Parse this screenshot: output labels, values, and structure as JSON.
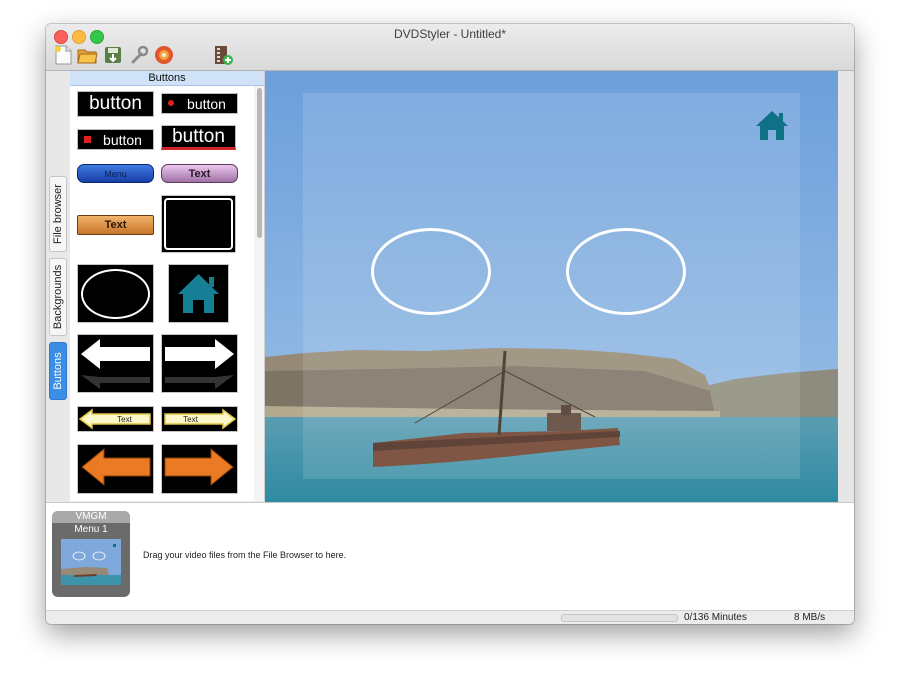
{
  "window": {
    "title": "DVDStyler - Untitled*"
  },
  "toolbar": {
    "icons": [
      "new-icon",
      "open-icon",
      "save-icon",
      "settings-icon",
      "burn-icon",
      "add-file-icon"
    ]
  },
  "sidebar": {
    "tabs": [
      {
        "label": "File browser"
      },
      {
        "label": "Backgrounds"
      },
      {
        "label": "Buttons"
      }
    ],
    "panel_title": "Buttons",
    "samples": {
      "button_label": "button",
      "menu_label": "Menu",
      "text_label": "Text"
    }
  },
  "canvas": {
    "accent": "#0f7185"
  },
  "titleset": {
    "vmgm_label": "VMGM",
    "menu_label": "Menu 1",
    "drop_hint": "Drag your video files from the File Browser to here."
  },
  "status": {
    "progress": 0,
    "minutes": "0/136 Minutes",
    "speed": "8 MB/s"
  }
}
